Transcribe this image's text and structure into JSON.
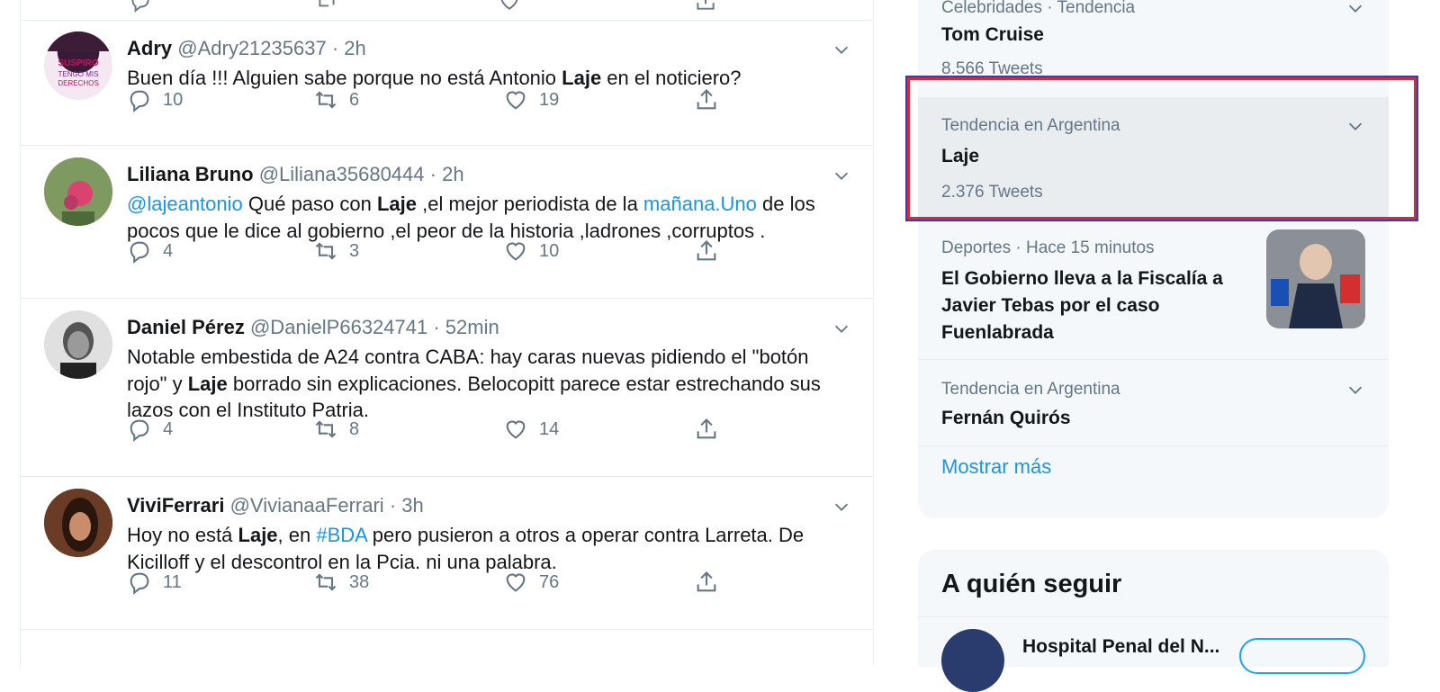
{
  "tweets": [
    {
      "name": "Adry",
      "handle": "@Adry21235637",
      "time": "· 2h",
      "text_1": "Buen día !!! Alguien sabe porque no está Antonio ",
      "text_bold": "Laje",
      "text_2": " en el noticiero?",
      "replies": "10",
      "retweets": "6",
      "likes": "19"
    },
    {
      "name": "Liliana Bruno",
      "handle": "@Liliana35680444",
      "time": "· 2h",
      "mention": "@lajeantonio",
      "text_1": " Qué  paso con ",
      "text_bold": "Laje",
      "text_2": " ,el mejor periodista de la ",
      "link": "mañana.Uno",
      "text_3": " de los pocos que le dice al gobierno  ,el peor de la historia ,ladrones ,corruptos .",
      "replies": "4",
      "retweets": "3",
      "likes": "10"
    },
    {
      "name": "Daniel Pérez",
      "handle": "@DanielP66324741",
      "time": "· 52min",
      "text_1": "Notable embestida de A24 contra CABA: hay caras nuevas pidiendo el \"botón rojo\" y ",
      "text_bold": "Laje",
      "text_2": " borrado sin explicaciones. Belocopitt parece estar estrechando sus lazos con el Instituto Patria.",
      "replies": "4",
      "retweets": "8",
      "likes": "14"
    },
    {
      "name": "ViviFerrari",
      "handle": "@VivianaaFerrari",
      "time": "· 3h",
      "text_1": "Hoy no está ",
      "text_bold": "Laje",
      "text_2": ", en ",
      "hashtag": "#BDA",
      "text_3": " pero pusieron a otros a operar contra Larreta. De Kicilloff y el descontrol en la Pcia. ni una palabra.",
      "replies": "11",
      "retweets": "38",
      "likes": "76"
    }
  ],
  "trends": [
    {
      "meta": "Celebridades · Tendencia",
      "title": "Tom Cruise",
      "count": "8.566 Tweets"
    },
    {
      "meta": "Tendencia en Argentina",
      "title": "Laje",
      "count": "2.376 Tweets"
    },
    {
      "meta": "Deportes · Hace 15 minutos",
      "title": "El Gobierno lleva a la Fiscalía a Javier Tebas por el caso Fuenlabrada"
    },
    {
      "meta": "Tendencia en Argentina",
      "title": "Fernán Quirós"
    }
  ],
  "show_more": "Mostrar más",
  "who_to_follow": {
    "title": "A quién seguir",
    "first_name": "Hospital Penal del N..."
  },
  "colors": {
    "link": "#1b95e0",
    "highlight_border": "#d62a3a",
    "highlight_outer": "#3b3bb0"
  }
}
